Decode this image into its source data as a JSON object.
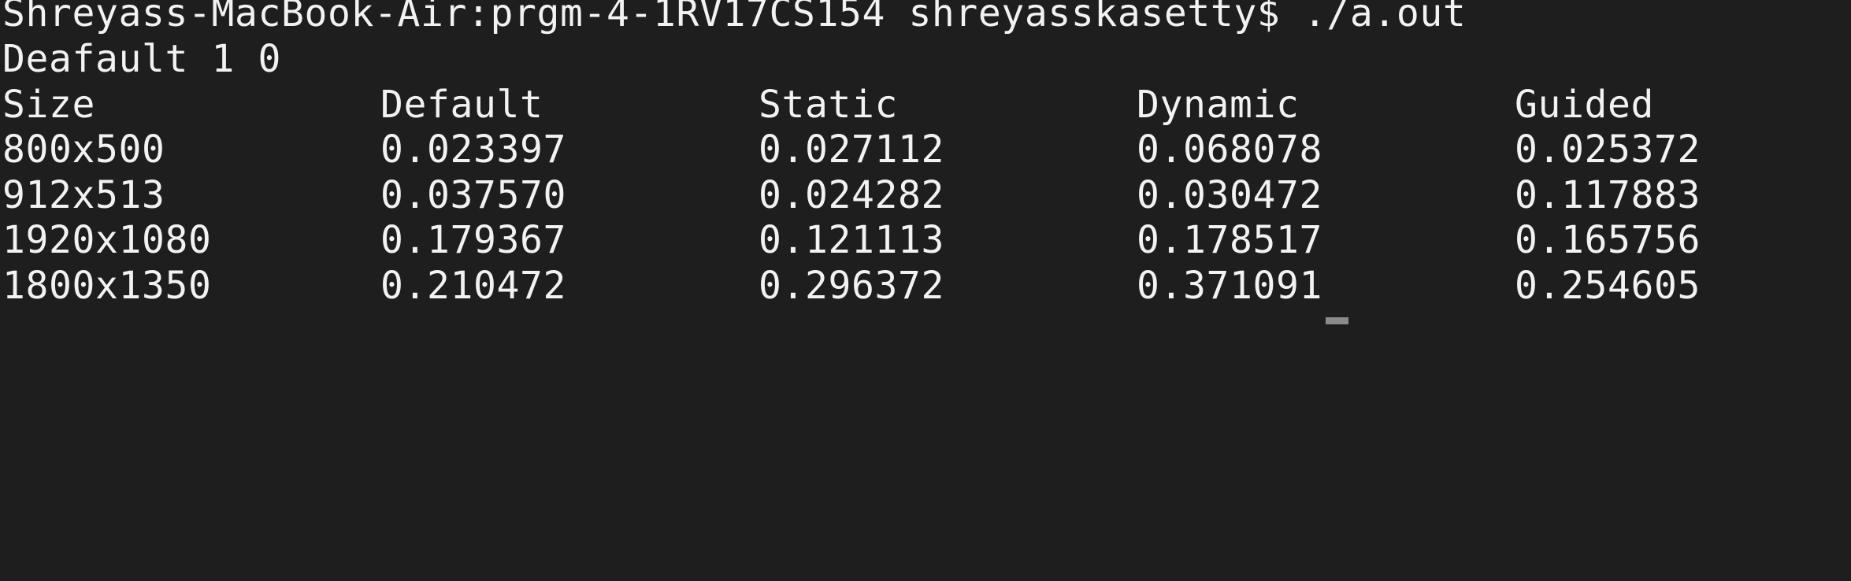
{
  "terminal": {
    "prompt_line": "Shreyass-MacBook-Air:prgm-4-1RV17CS154 shreyasskasetty$ ./a.out",
    "info_line": "Deafault 1 0",
    "table": {
      "headers": [
        "Size",
        "Default",
        "Static",
        "Dynamic",
        "Guided"
      ],
      "rows": [
        [
          "800x500",
          "0.023397",
          "0.027112",
          "0.068078",
          "0.025372"
        ],
        [
          "912x513",
          "0.037570",
          "0.024282",
          "0.030472",
          "0.117883"
        ],
        [
          "1920x1080",
          "0.179367",
          "0.121113",
          "0.178517",
          "0.165756"
        ],
        [
          "1800x1350",
          "0.210472",
          "0.296372",
          "0.371091",
          "0.254605"
        ]
      ]
    }
  },
  "colors": {
    "background": "#1e1e1e",
    "text": "#f2f2f2",
    "cursor": "#8a8a8a"
  }
}
